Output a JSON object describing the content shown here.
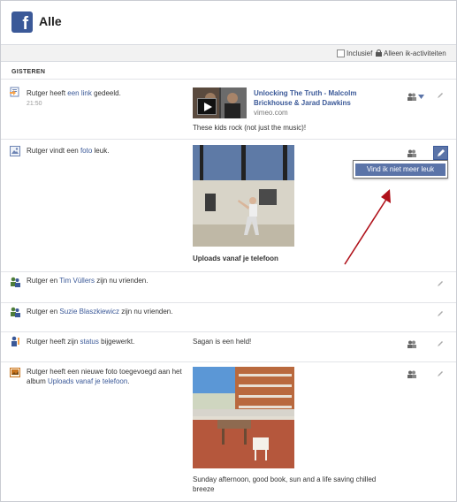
{
  "header": {
    "title": "Alle",
    "logo_letter": "f"
  },
  "filter": {
    "label": "Inclusief",
    "scope": "Alleen ik-activiteiten",
    "checked": false
  },
  "section": {
    "heading": "GISTEREN"
  },
  "rows": [
    {
      "actor": "Rutger",
      "text_before": "heeft",
      "link": "een link",
      "text_after": "gedeeld.",
      "time": "21:50",
      "link_title": "Unlocking The Truth - Malcolm Brickhouse & Jarad Dawkins",
      "link_domain": "vimeo.com",
      "caption": "These kids rock (not just the music)!"
    },
    {
      "actor": "Rutger",
      "text_before": "vindt een",
      "link": "foto",
      "text_after": "leuk.",
      "album_link": "Uploads vanaf je telefoon",
      "menu_item": "Vind ik niet meer leuk"
    },
    {
      "actor": "Rutger",
      "text_before": "en",
      "link": "Tim Vüllers",
      "text_after": "zijn nu vrienden."
    },
    {
      "actor": "Rutger",
      "text_before": "en",
      "link": "Suzie Blaszkiewicz",
      "text_after": "zijn nu vrienden."
    },
    {
      "actor": "Rutger",
      "text_before": "heeft zijn",
      "link": "status",
      "text_after": "bijgewerkt.",
      "caption": "Sagan is een held!"
    },
    {
      "actor": "Rutger",
      "text_before": "heeft een nieuwe foto toegevoegd aan het album",
      "link": "Uploads vanaf je telefoon",
      "text_after": ".",
      "caption": "Sunday afternoon, good book, sun and a life saving chilled breeze"
    }
  ],
  "colors": {
    "brand": "#3b5998",
    "arrow": "#b0121b",
    "menu_highlight": "#5b74a8"
  }
}
